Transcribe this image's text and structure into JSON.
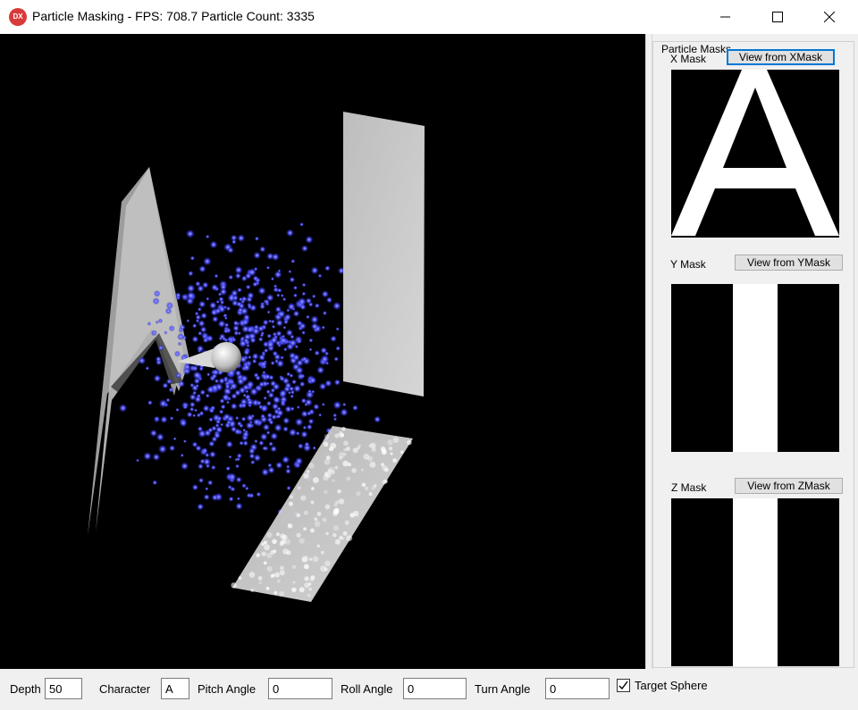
{
  "window": {
    "title": "Particle Masking - FPS: 708.7 Particle Count: 3335",
    "app_icon_text": "DX"
  },
  "side_panel": {
    "group_title": "Particle Masks",
    "x_mask": {
      "label": "X Mask",
      "button": "View from XMask"
    },
    "y_mask": {
      "label": "Y Mask",
      "button": "View from YMask"
    },
    "z_mask": {
      "label": "Z Mask",
      "button": "View from ZMask"
    }
  },
  "controls": {
    "depth": {
      "label": "Depth",
      "value": "50"
    },
    "character": {
      "label": "Character",
      "value": "A"
    },
    "pitch": {
      "label": "Pitch Angle",
      "value": "0"
    },
    "roll": {
      "label": "Roll Angle",
      "value": "0"
    },
    "turn": {
      "label": "Turn Angle",
      "value": "0"
    },
    "target_sphere": {
      "label": "Target Sphere",
      "checked": true
    }
  },
  "colors": {
    "particle": "#4a4cff",
    "plane": "#c8c8c8",
    "viewport_bg": "#000000",
    "focus_border": "#0078d7"
  }
}
